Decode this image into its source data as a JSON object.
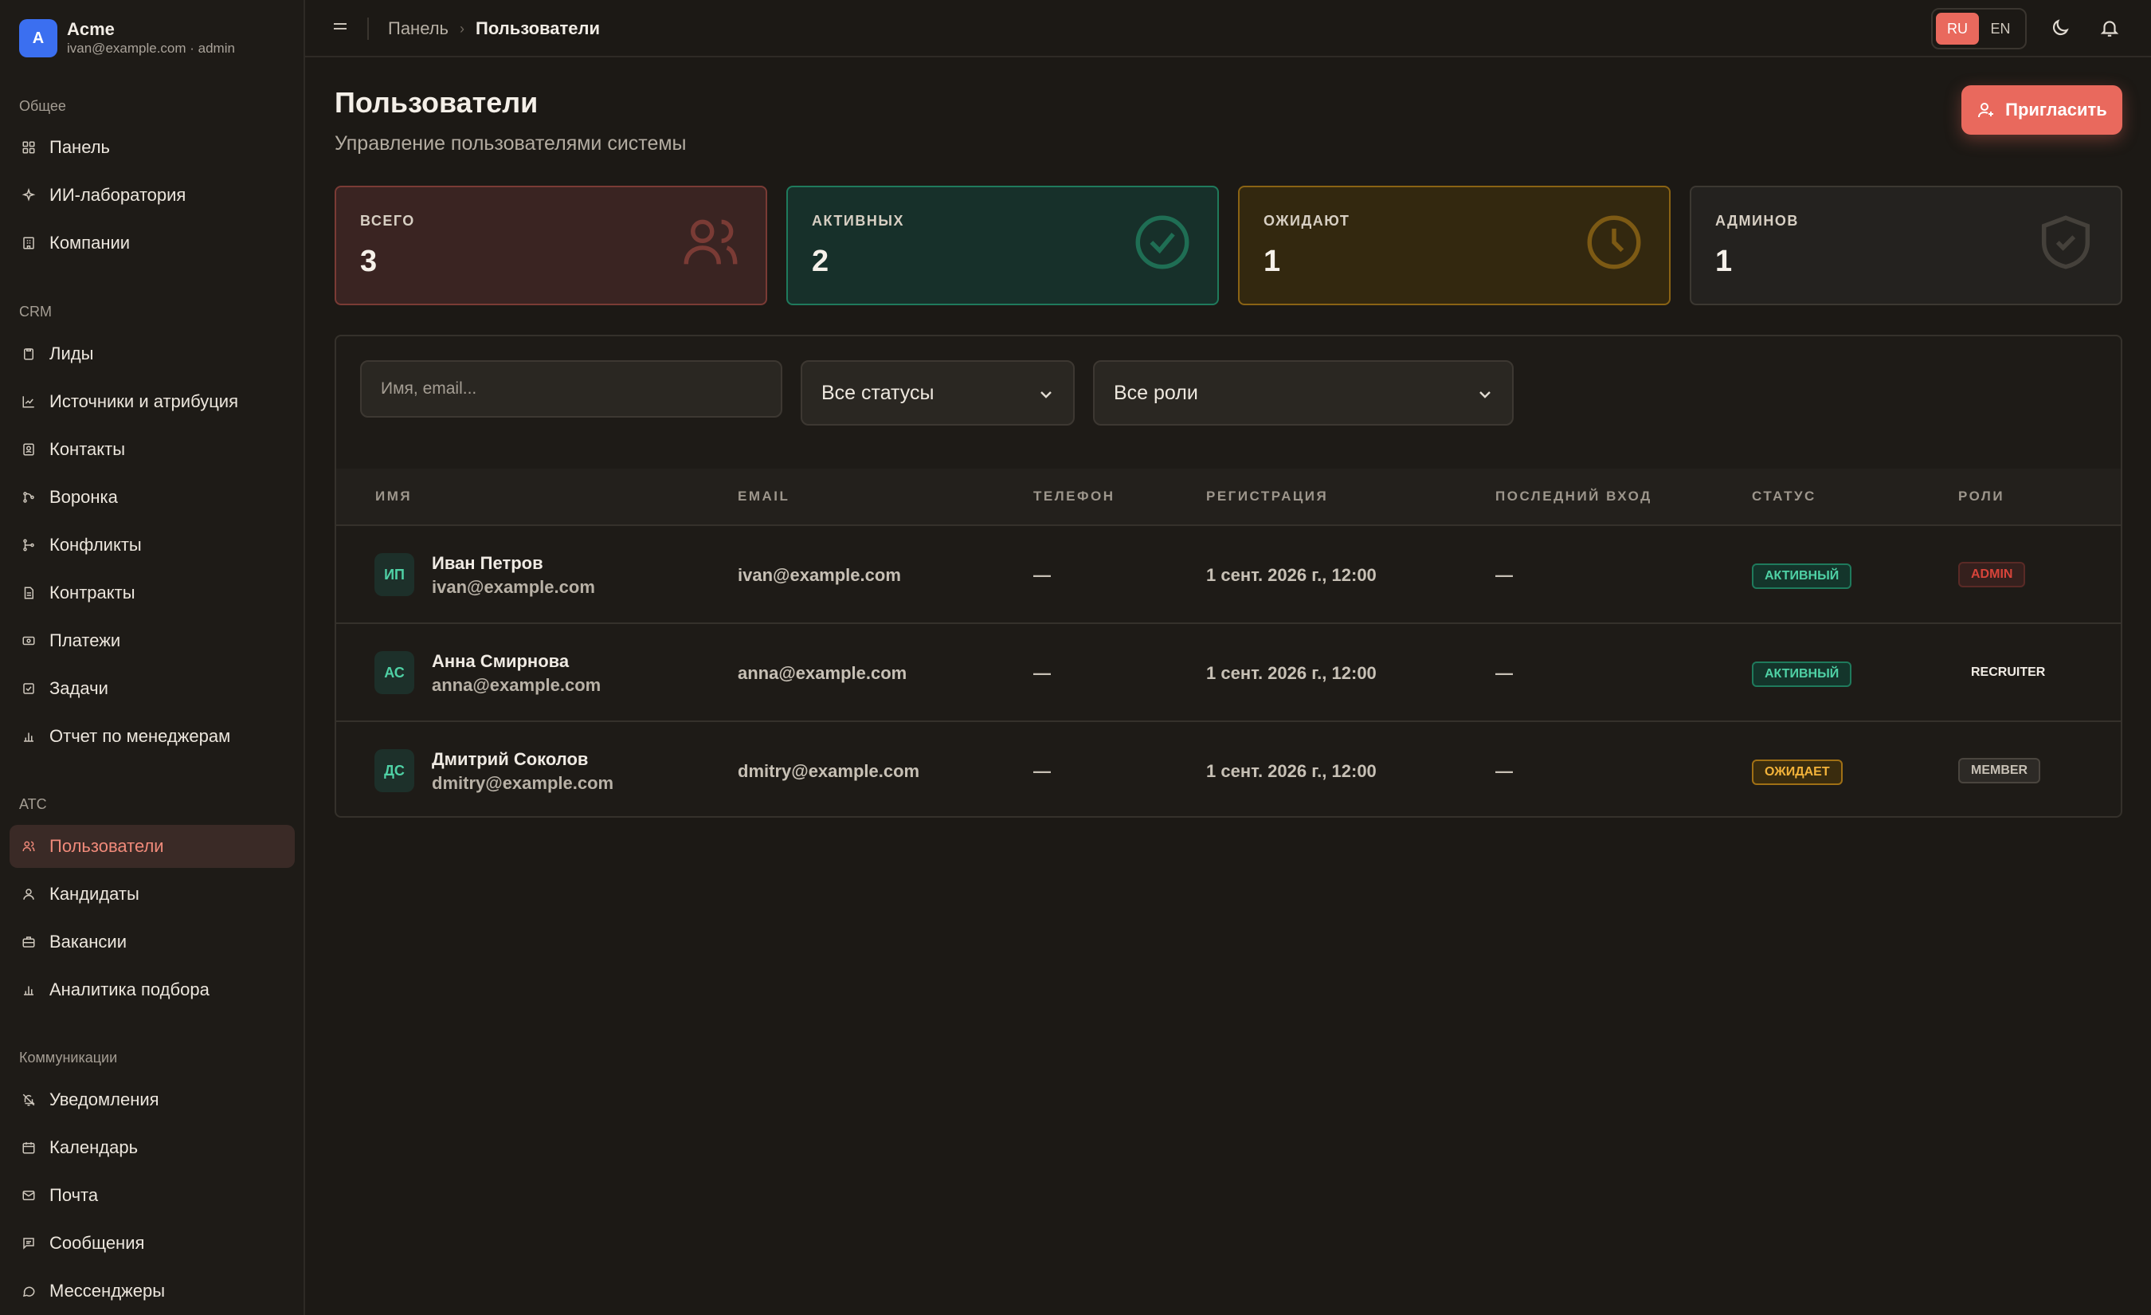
{
  "brand": {
    "logo_letter": "A",
    "name": "Acme",
    "subtitle": "ivan@example.com · admin"
  },
  "sidebar": {
    "sections": [
      {
        "title": "Общее",
        "items": [
          {
            "label": "Панель",
            "icon": "grid-icon"
          },
          {
            "label": "ИИ-лаборатория",
            "icon": "sparkles-icon"
          },
          {
            "label": "Компании",
            "icon": "building-icon"
          }
        ]
      },
      {
        "title": "CRM",
        "items": [
          {
            "label": "Лиды",
            "icon": "clipboard-icon"
          },
          {
            "label": "Источники и атрибуция",
            "icon": "chart-line-icon"
          },
          {
            "label": "Контакты",
            "icon": "contact-book-icon"
          },
          {
            "label": "Воронка",
            "icon": "git-merge-icon"
          },
          {
            "label": "Конфликты",
            "icon": "git-branch-icon"
          },
          {
            "label": "Контракты",
            "icon": "file-text-icon"
          },
          {
            "label": "Платежи",
            "icon": "banknote-icon"
          },
          {
            "label": "Задачи",
            "icon": "checkbox-icon"
          },
          {
            "label": "Отчет по менеджерам",
            "icon": "bar-chart-icon"
          }
        ]
      },
      {
        "title": "ATC",
        "items": [
          {
            "label": "Пользователи",
            "icon": "users-icon",
            "active": true
          },
          {
            "label": "Кандидаты",
            "icon": "user-icon"
          },
          {
            "label": "Вакансии",
            "icon": "briefcase-icon"
          },
          {
            "label": "Аналитика подбора",
            "icon": "bar-chart-icon"
          }
        ]
      },
      {
        "title": "Коммуникации",
        "items": [
          {
            "label": "Уведомления",
            "icon": "bell-off-icon"
          },
          {
            "label": "Календарь",
            "icon": "calendar-icon"
          },
          {
            "label": "Почта",
            "icon": "mail-icon"
          },
          {
            "label": "Сообщения",
            "icon": "message-square-icon"
          },
          {
            "label": "Мессенджеры",
            "icon": "message-circle-icon"
          }
        ]
      }
    ]
  },
  "topbar": {
    "breadcrumb": [
      "Панель",
      "Пользователи"
    ],
    "breadcrumb_sep": "›",
    "languages": [
      "RU",
      "EN"
    ],
    "active_language": "RU",
    "icons": [
      "menu-icon",
      "moon-icon",
      "bell-icon"
    ]
  },
  "page": {
    "title": "Пользователи",
    "subtitle": "Управление пользователями системы",
    "invite_label": "Пригласить"
  },
  "stats": [
    {
      "label": "ВСЕГО",
      "value": "3",
      "icon": "users-icon",
      "color": "#7a3b35"
    },
    {
      "label": "АКТИВНЫХ",
      "value": "2",
      "icon": "check-circle-icon",
      "color": "#1f7a5c"
    },
    {
      "label": "ОЖИДАЮТ",
      "value": "1",
      "icon": "clock-icon",
      "color": "#8a6314"
    },
    {
      "label": "АДМИНОВ",
      "value": "1",
      "icon": "shield-check-icon",
      "color": "#3c3832"
    }
  ],
  "filters": {
    "search_placeholder": "Имя, email...",
    "search_value": "",
    "status_selected": "Все статусы",
    "role_selected": "Все роли"
  },
  "table": {
    "columns": [
      "ИМЯ",
      "EMAIL",
      "ТЕЛЕФОН",
      "РЕГИСТРАЦИЯ",
      "ПОСЛЕДНИЙ ВХОД",
      "СТАТУС",
      "РОЛИ"
    ],
    "rows": [
      {
        "initials": "ИП",
        "name": "Иван Петров",
        "email": "ivan@example.com",
        "phone": "—",
        "registered": "1 сент. 2026 г., 12:00",
        "last_login": "—",
        "status": "АКТИВНЫЙ",
        "role": "ADMIN"
      },
      {
        "initials": "АС",
        "name": "Анна Смирнова",
        "email": "anna@example.com",
        "phone": "—",
        "registered": "1 сент. 2026 г., 12:00",
        "last_login": "—",
        "status": "АКТИВНЫЙ",
        "role": "RECRUITER"
      },
      {
        "initials": "ДС",
        "name": "Дмитрий Соколов",
        "email": "dmitry@example.com",
        "phone": "—",
        "registered": "1 сент. 2026 г., 12:00",
        "last_login": "—",
        "status": "ОЖИДАЕТ",
        "role": "MEMBER"
      }
    ]
  },
  "colors": {
    "accent": "#e9695d",
    "active": "#4fd1a5",
    "pending": "#f3b33a",
    "admin_role": "#d7443a",
    "background": "#1c1915"
  }
}
